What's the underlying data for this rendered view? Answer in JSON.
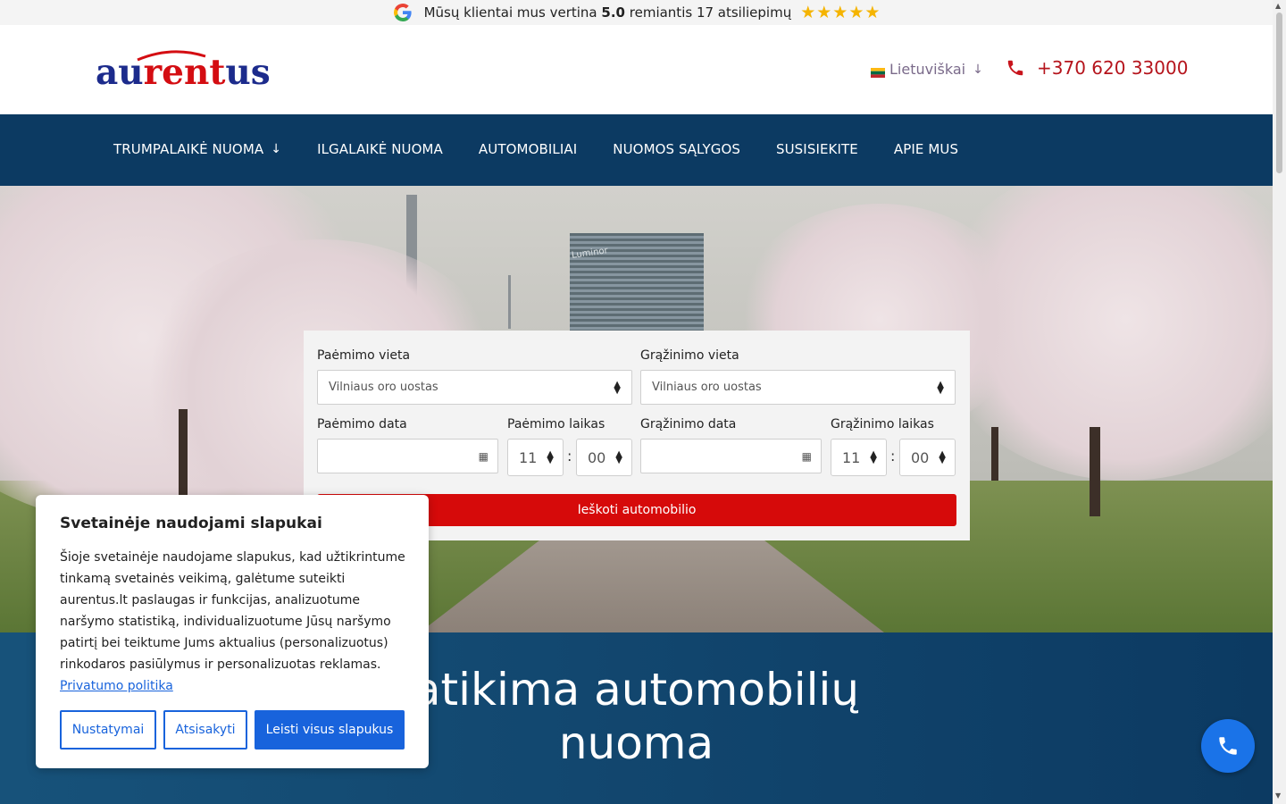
{
  "review_bar": {
    "text_before": "Mūsų klientai mus vertina",
    "rating": "5.0",
    "text_after": "remiantis 17 atsiliepimų",
    "stars": "★★★★★",
    "icon": "google-icon"
  },
  "header": {
    "logo": {
      "part1": "au",
      "part2": "rent",
      "part3": "us"
    },
    "language": {
      "label": "Lietuviškai",
      "icon": "lithuania-flag-icon"
    },
    "phone": {
      "number": "+370 620 33000",
      "icon": "phone-icon"
    }
  },
  "nav": {
    "items": [
      {
        "label": "TRUMPALAIKĖ NUOMA",
        "has_dropdown": true
      },
      {
        "label": "ILGALAIKĖ NUOMA"
      },
      {
        "label": "AUTOMOBILIAI"
      },
      {
        "label": "NUOMOS SĄLYGOS"
      },
      {
        "label": "SUSISIEKITE"
      },
      {
        "label": "APIE MUS"
      }
    ]
  },
  "hero": {
    "tower_text": "Luminor"
  },
  "booking": {
    "pickup_location": {
      "label": "Paėmimo vieta",
      "value": "Vilniaus oro uostas"
    },
    "return_location": {
      "label": "Grąžinimo vieta",
      "value": "Vilniaus oro uostas"
    },
    "pickup_date": {
      "label": "Paėmimo data",
      "value": ""
    },
    "pickup_time": {
      "label": "Paėmimo laikas",
      "hour": "11",
      "minute": "00"
    },
    "return_date": {
      "label": "Grąžinimo data",
      "value": ""
    },
    "return_time": {
      "label": "Grąžinimo laikas",
      "hour": "11",
      "minute": "00"
    },
    "search_button": "Ieškoti automobilio"
  },
  "band": {
    "title_line1": "atikima automobilių",
    "title_line2": "nuoma"
  },
  "cookie": {
    "title": "Svetainėje naudojami slapukai",
    "body": "Šioje svetainėje naudojame slapukus, kad užtikrintume tinkamą svetainės veikimą, galėtume suteikti aurentus.lt  paslaugas ir funkcijas, analizuotume naršymo statistiką, individualizuotume Jūsų naršymo patirtį bei teiktume Jums aktualius (personalizuotus) rinkodaros pasiūlymus ir personalizuotas reklamas.",
    "link": "Privatumo politika",
    "buttons": {
      "settings": "Nustatymai",
      "reject": "Atsisakyti",
      "accept_all": "Leisti visus slapukus"
    }
  },
  "colors": {
    "nav_bg": "#0c3a62",
    "brand_red": "#d60a0a",
    "accent_blue": "#1863dc",
    "star_color": "#f5b400"
  }
}
